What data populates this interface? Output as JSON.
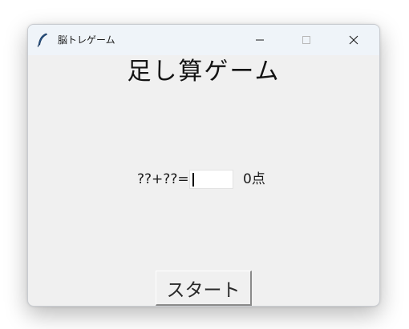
{
  "window": {
    "title": "脳トレゲーム",
    "icon": "feather-icon",
    "controls": [
      "minimize-icon",
      "maximize-icon",
      "close-icon"
    ]
  },
  "main": {
    "heading": "足し算ゲーム",
    "problem": "??+??=",
    "answer_value": "",
    "score": "0点",
    "start_label": "スタート"
  }
}
